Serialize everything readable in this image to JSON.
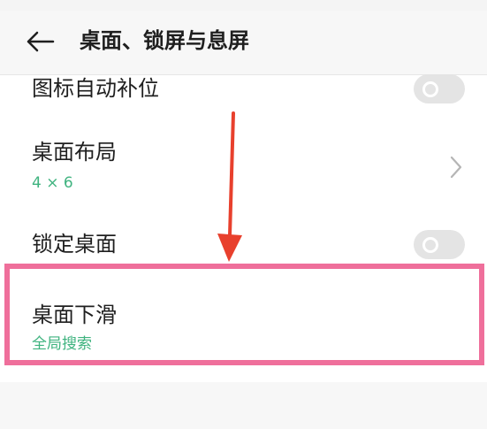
{
  "header": {
    "title": "桌面、锁屏与息屏"
  },
  "settings": {
    "icon_auto_fill": {
      "label": "图标自动补位",
      "enabled": false
    },
    "desktop_layout": {
      "label": "桌面布局",
      "value": "4 × 6"
    },
    "lock_desktop": {
      "label": "锁定桌面",
      "enabled": false
    },
    "desktop_swipe_down": {
      "label": "桌面下滑",
      "value": "全局搜索"
    }
  },
  "annotation": {
    "arrow_color": "#e8402d",
    "highlight_color": "#ef6f9b"
  },
  "colors": {
    "accent": "#3fb37f",
    "toggle_off": "#e4e4e4"
  },
  "icons": [
    "back-arrow-icon",
    "chevron-right-icon",
    "toggle-switch"
  ]
}
